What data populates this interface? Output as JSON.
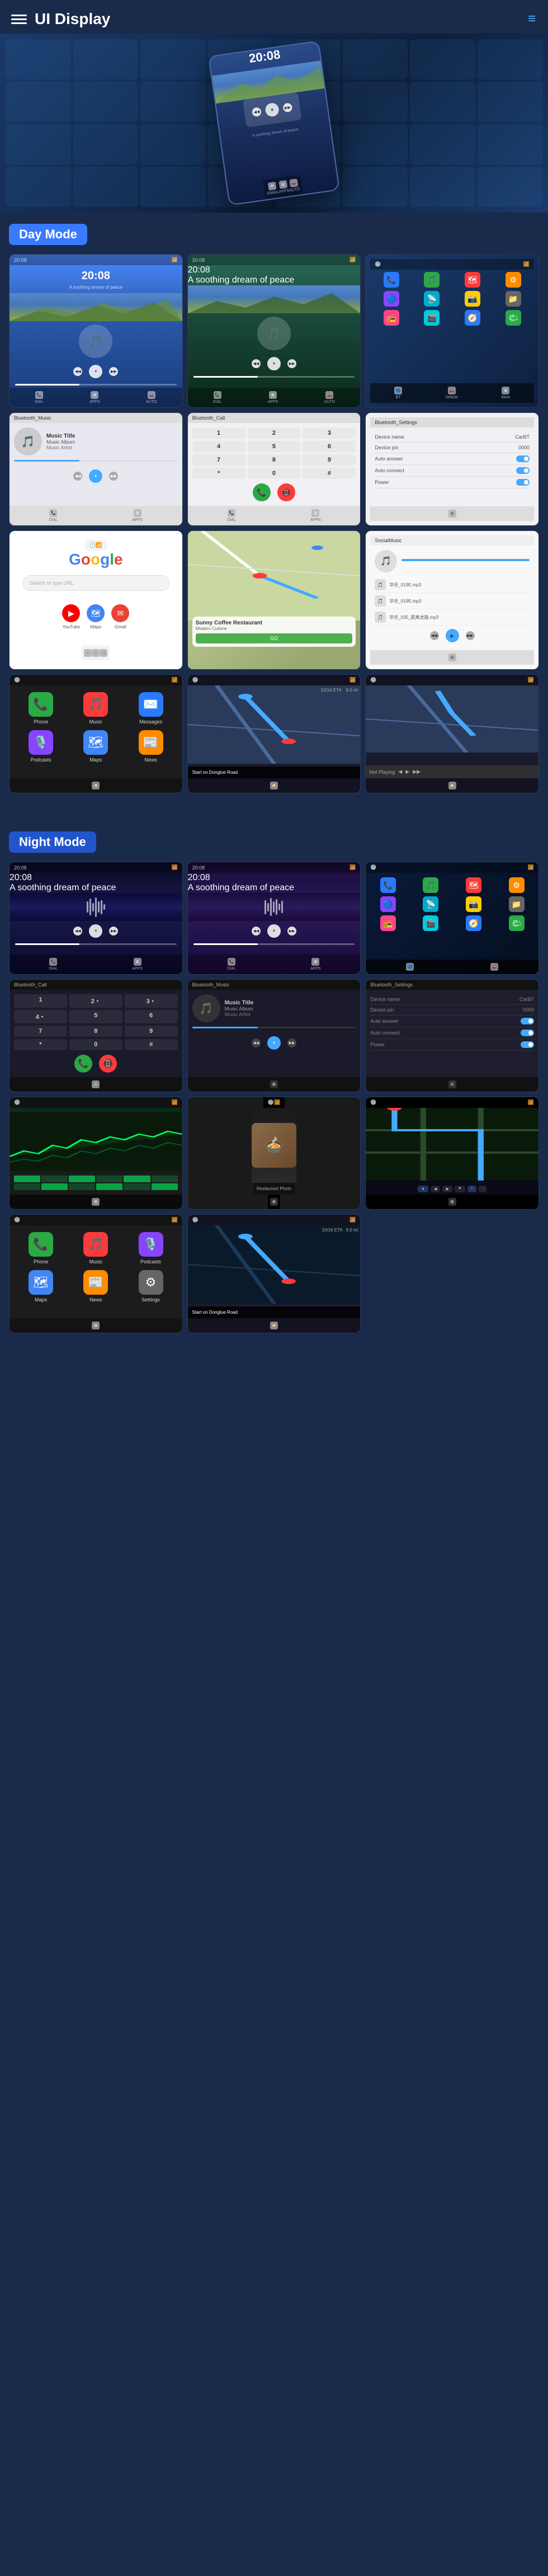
{
  "header": {
    "title": "UI Display",
    "menu_icon": "menu",
    "more_icon": "≡"
  },
  "hero": {
    "time": "20:08",
    "subtitle": "A soothing dream of peace"
  },
  "day_mode": {
    "label": "Day Mode",
    "screens": [
      {
        "id": "day-music-1",
        "type": "music",
        "time": "20:08",
        "subtitle": "A soothing dream of peace",
        "theme": "blue-gradient"
      },
      {
        "id": "day-music-2",
        "type": "music",
        "time": "20:08",
        "subtitle": "A soothing dream of peace",
        "theme": "teal-gradient"
      },
      {
        "id": "day-apps",
        "type": "app-grid",
        "theme": "dark-blue"
      }
    ],
    "row2": [
      {
        "id": "bt-music",
        "type": "bluetooth-music",
        "title": "Bluetooth_Music",
        "track_title": "Music Title",
        "album": "Music Album",
        "artist": "Music Artist"
      },
      {
        "id": "bt-call",
        "type": "bluetooth-call",
        "title": "Bluetooth_Call"
      },
      {
        "id": "bt-settings",
        "type": "bluetooth-settings",
        "title": "Bluetooth_Settings",
        "fields": [
          {
            "label": "Device name",
            "value": "CarBT"
          },
          {
            "label": "Device pin",
            "value": "0000"
          },
          {
            "label": "Auto answer",
            "value": "toggle-on"
          },
          {
            "label": "Auto connect",
            "value": "toggle-on"
          },
          {
            "label": "Power",
            "value": "toggle-on"
          }
        ]
      }
    ],
    "row3": [
      {
        "id": "google-screen",
        "type": "google",
        "logo": "Google",
        "search_placeholder": "Search or type URL"
      },
      {
        "id": "map-screen",
        "type": "map",
        "restaurant": "Sunny Coffee Restaurant",
        "address": "Modern Cuisine",
        "go_label": "GO"
      },
      {
        "id": "social-music",
        "type": "social-music",
        "title": "SocialMusic",
        "tracks": [
          "华乐_019E.mp3",
          "华乐_019E.mp3",
          "华乐_035_距离龙路.mp3"
        ]
      }
    ],
    "row4": [
      {
        "id": "carplay-apps",
        "type": "carplay",
        "apps": [
          {
            "icon": "📞",
            "label": "Phone",
            "color": "#2aaa44"
          },
          {
            "icon": "🎵",
            "label": "Music",
            "color": "#ff3a3a"
          },
          {
            "icon": "✉️",
            "label": "Messages",
            "color": "#2a7aff"
          }
        ]
      },
      {
        "id": "nav-map",
        "type": "navigation",
        "eta": "10/16 ETA",
        "distance": "9.0 mi",
        "instruction": "Start on Donglue Road"
      },
      {
        "id": "nav-playing",
        "type": "nav-with-music",
        "not_playing": "Not Playing"
      }
    ]
  },
  "night_mode": {
    "label": "Night Mode",
    "screens": [
      {
        "id": "night-music-1",
        "type": "music",
        "time": "20:08",
        "subtitle": "A soothing dream of peace",
        "theme": "night-blue"
      },
      {
        "id": "night-music-2",
        "type": "music",
        "time": "20:08",
        "subtitle": "A soothing dream of peace",
        "theme": "night-purple"
      },
      {
        "id": "night-apps",
        "type": "app-grid-night",
        "theme": "night-dark"
      }
    ],
    "row2": [
      {
        "id": "night-bt-call",
        "type": "bluetooth-call-night",
        "title": "Bluetooth_Call"
      },
      {
        "id": "night-bt-music",
        "type": "bluetooth-music-night",
        "title": "Bluetooth_Music",
        "track_title": "Music Title",
        "album": "Music Album",
        "artist": "Music Artist"
      },
      {
        "id": "night-bt-settings",
        "type": "bluetooth-settings-night",
        "title": "Bluetooth_Settings"
      }
    ],
    "row3": [
      {
        "id": "night-terrain",
        "type": "terrain",
        "theme": "night"
      },
      {
        "id": "night-food",
        "type": "food-photo",
        "theme": "night"
      },
      {
        "id": "night-roads",
        "type": "roads",
        "theme": "night"
      }
    ],
    "row4": [
      {
        "id": "night-carplay",
        "type": "carplay-night",
        "apps": [
          {
            "icon": "📞",
            "label": "Phone",
            "color": "#2aaa44"
          },
          {
            "icon": "🎵",
            "label": "Music",
            "color": "#ff3a3a"
          },
          {
            "icon": "🎙️",
            "label": "Podcast",
            "color": "#8844ff"
          }
        ]
      },
      {
        "id": "night-nav",
        "type": "navigation-night",
        "eta": "10/16 ETA",
        "distance": "9.0 mi",
        "instruction": "Start on Donglue Road"
      }
    ]
  },
  "colors": {
    "primary_blue": "#3a7aff",
    "night_bg": "#0a0a2a",
    "day_bg": "#1a2a4a",
    "accent": "#4af",
    "green": "#2aaa44",
    "red": "#ff3a3a"
  }
}
